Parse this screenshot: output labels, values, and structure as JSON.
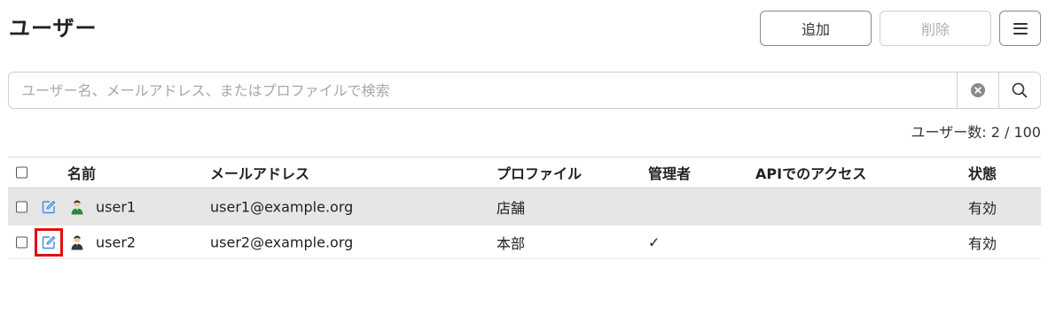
{
  "page": {
    "title": "ユーザー"
  },
  "toolbar": {
    "add_label": "追加",
    "delete_label": "削除",
    "menu_icon": "hamburger-menu-icon"
  },
  "search": {
    "placeholder": "ユーザー名、メールアドレス、またはプロファイルで検索",
    "value": "",
    "clear_icon": "clear-circle-icon",
    "search_icon": "search-icon"
  },
  "summary": {
    "user_count": "ユーザー数: 2 / 100"
  },
  "table": {
    "columns": {
      "name": "名前",
      "email": "メールアドレス",
      "profile": "プロファイル",
      "admin": "管理者",
      "api_access": "APIでのアクセス",
      "status": "状態"
    },
    "rows": [
      {
        "name": "user1",
        "email": "user1@example.org",
        "profile": "店舗",
        "admin": "",
        "api_access": "",
        "status": "有効",
        "highlighted": true
      },
      {
        "name": "user2",
        "email": "user2@example.org",
        "profile": "本部",
        "admin": "✓",
        "api_access": "",
        "status": "有効",
        "highlighted": false
      }
    ]
  },
  "colors": {
    "edit_icon": "#3d8fe0",
    "row_highlight": "#e6e6e6",
    "annotation_box": "#e01010"
  }
}
